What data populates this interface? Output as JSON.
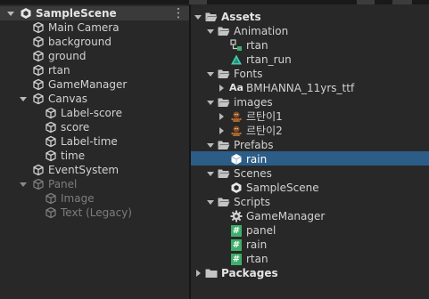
{
  "hierarchy": {
    "scene_name": "SampleScene",
    "items": [
      {
        "label": "Main Camera"
      },
      {
        "label": "background"
      },
      {
        "label": "ground"
      },
      {
        "label": "rtan"
      },
      {
        "label": "GameManager"
      },
      {
        "label": "Canvas"
      },
      {
        "label": "Label-score"
      },
      {
        "label": "score"
      },
      {
        "label": "Label-time"
      },
      {
        "label": "time"
      },
      {
        "label": "EventSystem"
      },
      {
        "label": "Panel"
      },
      {
        "label": "Image"
      },
      {
        "label": "Text (Legacy)"
      }
    ]
  },
  "project": {
    "items": [
      {
        "label": "Assets"
      },
      {
        "label": "Animation"
      },
      {
        "label": "rtan"
      },
      {
        "label": "rtan_run"
      },
      {
        "label": "Fonts"
      },
      {
        "label": "BMHANNA_11yrs_ttf"
      },
      {
        "label": "images"
      },
      {
        "label": "르탄이1"
      },
      {
        "label": "르탄이2"
      },
      {
        "label": "Prefabs"
      },
      {
        "label": "rain"
      },
      {
        "label": "Scenes"
      },
      {
        "label": "SampleScene"
      },
      {
        "label": "Scripts"
      },
      {
        "label": "GameManager"
      },
      {
        "label": "panel"
      },
      {
        "label": "rain"
      },
      {
        "label": "rtan"
      },
      {
        "label": "Packages"
      }
    ],
    "font_icon_text": "Aa",
    "script_icon_text": "#"
  },
  "colors": {
    "selection": "#2c5d87",
    "script_green": "#3fae6a",
    "folder": "#c4c4c4",
    "cube": "#cfcfcf"
  }
}
